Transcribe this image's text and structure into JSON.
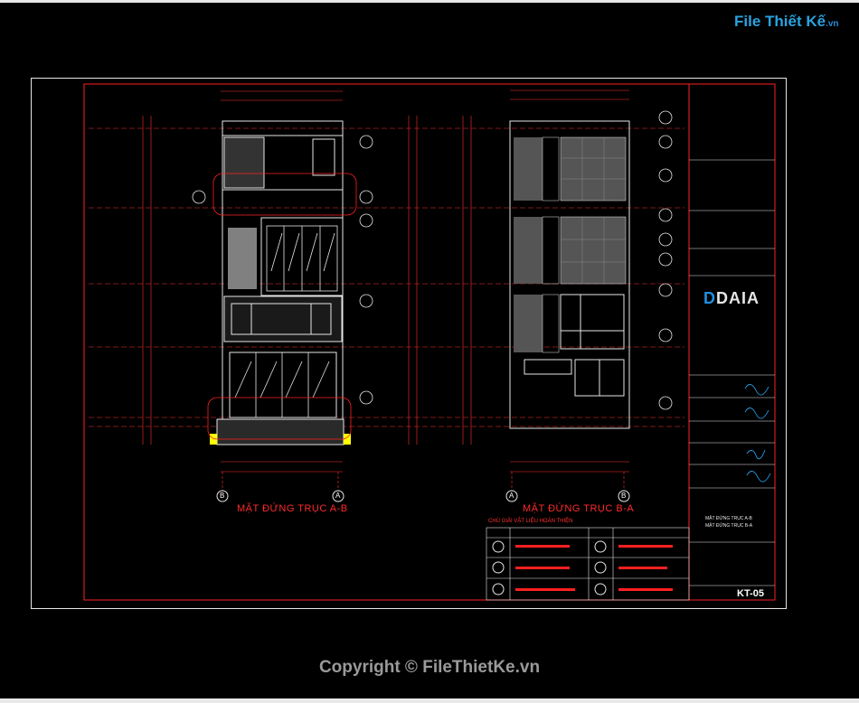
{
  "watermark_logo": {
    "name": "File Thiết Kế",
    "suffix": ".vn"
  },
  "copyright": "Copyright © FileThietKe.vn",
  "views": {
    "left_title": "MẶT ĐỨNG TRỤC A-B",
    "right_title": "MẶT ĐỨNG TRỤC B-A",
    "grid_left": [
      "B",
      "A"
    ],
    "grid_right": [
      "A",
      "B"
    ]
  },
  "finish_table": {
    "title": "CHÚ GIẢI VẬT LIỆU HOÀN THIỆN"
  },
  "title_block": {
    "company": "DAIA",
    "sheet_code": "KT-05",
    "drawing_names": [
      "MẶT ĐỨNG TRỤC A-B",
      "MẶT ĐỨNG TRỤC B-A"
    ]
  },
  "colors": {
    "background": "#000000",
    "cad_red": "#ff2020",
    "cad_white": "#e6e6e6",
    "accent_blue": "#29a3e0"
  }
}
